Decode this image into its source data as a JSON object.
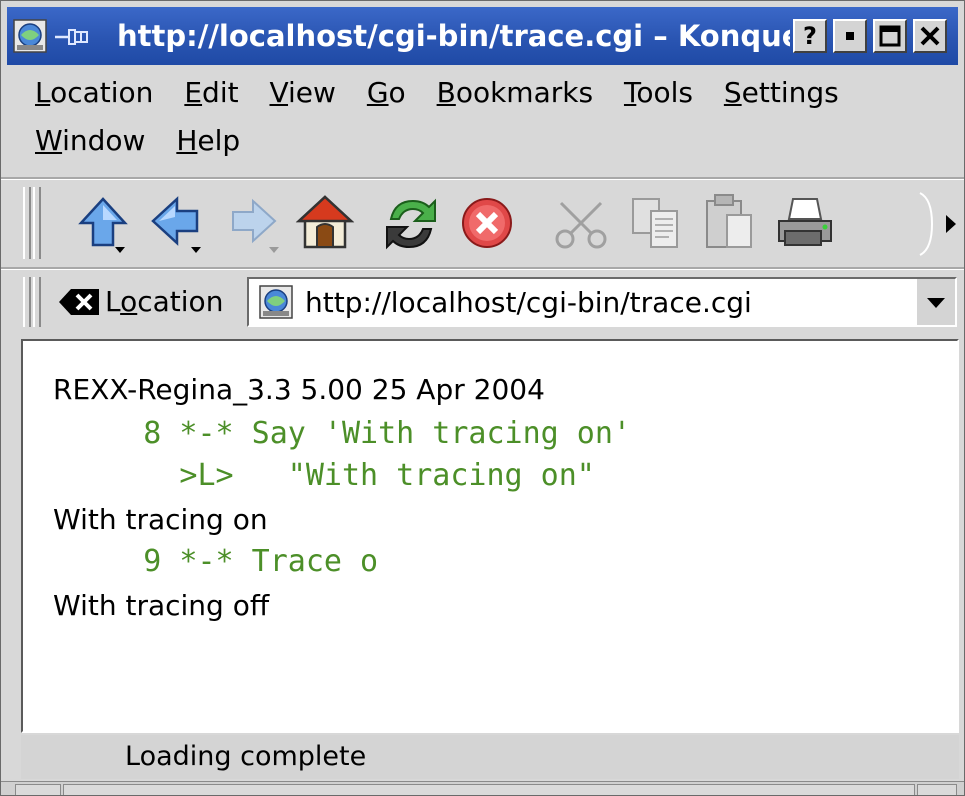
{
  "window": {
    "title": "http://localhost/cgi-bin/trace.cgi – Konqueror",
    "help_label": "?"
  },
  "menus": [
    {
      "accel": "L",
      "rest": "ocation"
    },
    {
      "accel": "E",
      "rest": "dit"
    },
    {
      "accel": "V",
      "rest": "iew"
    },
    {
      "accel": "G",
      "rest": "o"
    },
    {
      "accel": "B",
      "rest": "ookmarks"
    },
    {
      "accel": "T",
      "rest": "ools"
    },
    {
      "accel": "S",
      "rest": "ettings"
    },
    {
      "accel": "W",
      "rest": "indow"
    },
    {
      "accel": "H",
      "rest": "elp"
    }
  ],
  "toolbar": {
    "icons": [
      "up-arrow-icon",
      "back-arrow-icon",
      "forward-arrow-icon",
      "home-icon",
      "reload-icon",
      "stop-icon",
      "cut-icon",
      "copy-icon",
      "paste-icon",
      "print-icon"
    ]
  },
  "location": {
    "label_pre": "L",
    "label_accel": "o",
    "label_post": "cation",
    "url": "http://localhost/cgi-bin/trace.cgi"
  },
  "content": {
    "lines": [
      "REXX-Regina_3.3 5.00 25 Apr 2004",
      "     8 *-* Say 'With tracing on'",
      "       >L>   \"With tracing on\"",
      "With tracing on",
      "     9 *-* Trace o",
      "With tracing off"
    ]
  },
  "status": {
    "text": "Loading complete"
  },
  "colors": {
    "titlebar": "#2a55b2",
    "trace_text": "#4c8f28",
    "chrome": "#d8d8d8"
  }
}
